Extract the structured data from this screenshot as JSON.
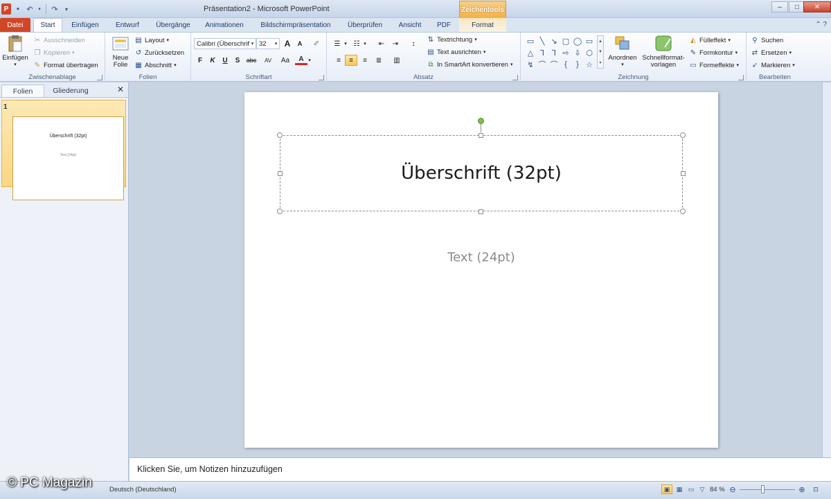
{
  "window": {
    "title": "Präsentation2 - Microsoft PowerPoint",
    "context_tab": "Zeichentools",
    "app_icon": "P",
    "controls": {
      "minimize": "–",
      "maximize": "□",
      "close": "✕"
    }
  },
  "tabs": [
    {
      "label": "Datei"
    },
    {
      "label": "Start"
    },
    {
      "label": "Einfügen"
    },
    {
      "label": "Entwurf"
    },
    {
      "label": "Übergänge"
    },
    {
      "label": "Animationen"
    },
    {
      "label": "Bildschirmpräsentation"
    },
    {
      "label": "Überprüfen"
    },
    {
      "label": "Ansicht"
    },
    {
      "label": "PDF"
    },
    {
      "label": "Format"
    }
  ],
  "ribbon": {
    "zwischenablage": {
      "label": "Zwischenablage",
      "paste": "Einfügen",
      "cut": "Ausschneiden",
      "copy": "Kopieren",
      "format_painter": "Format übertragen"
    },
    "folien": {
      "label": "Folien",
      "new_slide_line1": "Neue",
      "new_slide_line2": "Folie",
      "layout": "Layout",
      "reset": "Zurücksetzen",
      "section": "Abschnitt"
    },
    "schriftart": {
      "label": "Schriftart",
      "font_name": "Calibri (Überschrif",
      "font_size": "32",
      "bold": "F",
      "italic": "K",
      "underline": "U",
      "shadow": "S",
      "strike": "abc",
      "spacing": "AV",
      "case": "Aa",
      "color": "A",
      "grow": "A",
      "shrink": "A"
    },
    "absatz": {
      "label": "Absatz",
      "text_direction": "Textrichtung",
      "align_text": "Text ausrichten",
      "smartart": "In SmartArt konvertieren"
    },
    "zeichnung": {
      "label": "Zeichnung",
      "arrange": "Anordnen",
      "quick_styles_line1": "Schnellformat-",
      "quick_styles_line2": "vorlagen",
      "fill": "Fülleffekt",
      "outline": "Formkontur",
      "effects": "Formeffekte",
      "shapes": [
        "▭",
        "╲",
        "↘",
        "▢",
        "◯",
        "▭",
        "△",
        "⅂",
        "⅂",
        "⇨",
        "⇩",
        "⬡",
        "↯",
        "⌒",
        "⌒",
        "{",
        "}",
        "☆"
      ]
    },
    "bearbeiten": {
      "label": "Bearbeiten",
      "find": "Suchen",
      "replace": "Ersetzen",
      "select": "Markieren"
    }
  },
  "left_panel": {
    "tab_slides": "Folien",
    "tab_outline": "Gliederung",
    "close": "✕",
    "thumbnail": {
      "number": "1",
      "title": "Überschrift (32pt)",
      "text": "Text (24pt)"
    }
  },
  "slide": {
    "title": "Überschrift (32pt)",
    "body": "Text (24pt)"
  },
  "notes": {
    "placeholder": "Klicken Sie, um Notizen hinzuzufügen"
  },
  "status": {
    "language": "Deutsch (Deutschland)",
    "zoom": "84 %",
    "zoom_level": 0.42
  },
  "watermark": "© PC Magazin"
}
